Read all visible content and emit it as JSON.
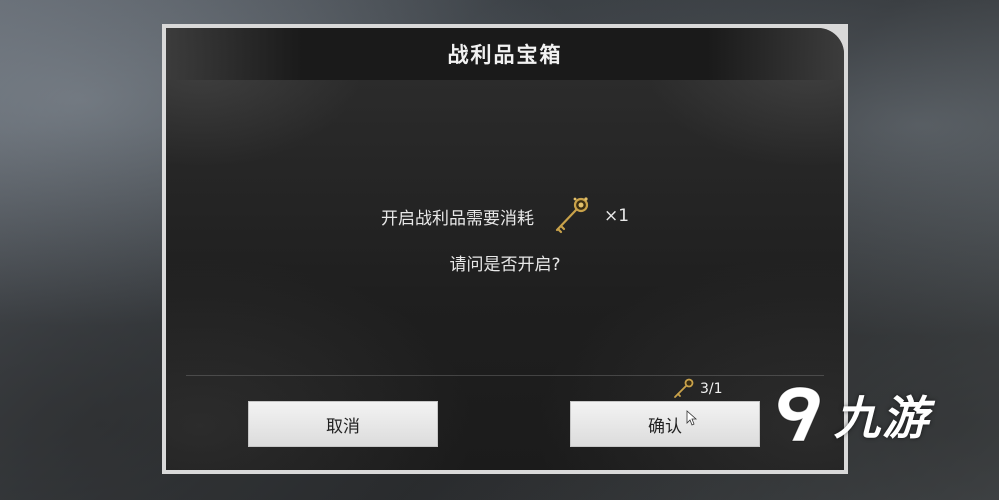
{
  "dialog": {
    "title": "战利品宝箱",
    "message_prefix": "开启战利品需要消耗",
    "cost_multiplier": "×1",
    "question": "请问是否开启?",
    "cancel_label": "取消",
    "confirm_label": "确认",
    "key_count": "3/1",
    "cost_icon": "golden-key-icon"
  },
  "watermark": {
    "text": "九游",
    "logo": "jiuyou-logo-icon"
  },
  "colors": {
    "panel_bg": "#1f1f1f",
    "frame": "#d9d9d9",
    "button_bg": "#e8e8e8",
    "key_gold": "#c9a24a"
  }
}
